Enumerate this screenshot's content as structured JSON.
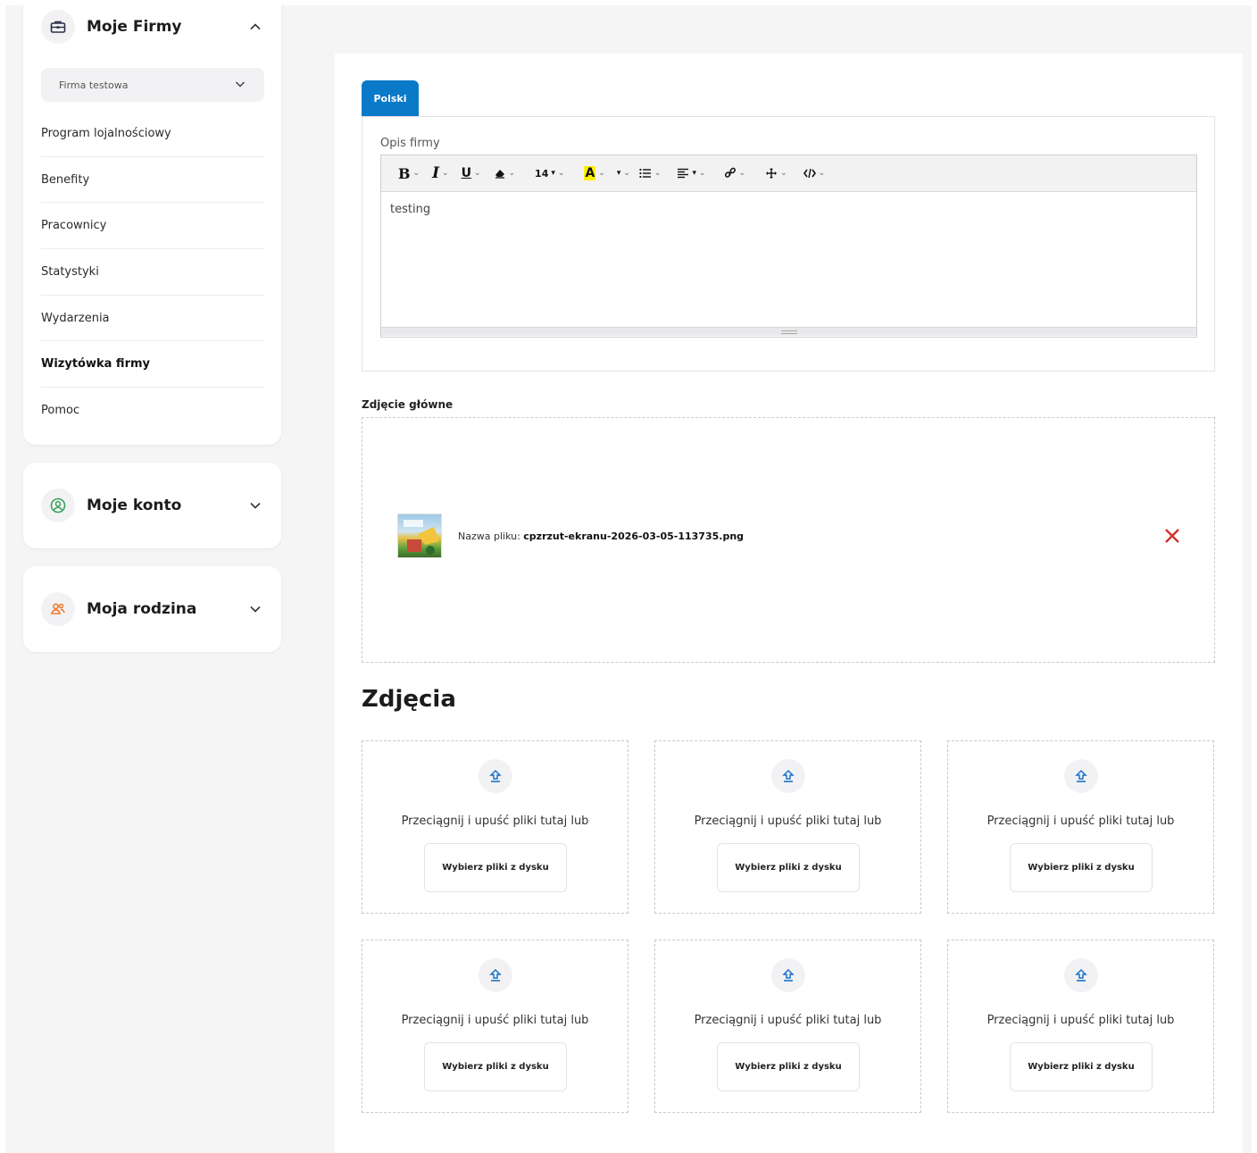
{
  "sidebar": {
    "companies": {
      "title": "Moje Firmy",
      "selected_firm": "Firma testowa",
      "menu": [
        {
          "label": "Program lojalnościowy",
          "active": false
        },
        {
          "label": "Benefity",
          "active": false
        },
        {
          "label": "Pracownicy",
          "active": false
        },
        {
          "label": "Statystyki",
          "active": false
        },
        {
          "label": "Wydarzenia",
          "active": false
        },
        {
          "label": "Wizytówka firmy",
          "active": true
        },
        {
          "label": "Pomoc",
          "active": false
        }
      ]
    },
    "account": {
      "title": "Moje konto"
    },
    "family": {
      "title": "Moja rodzina"
    }
  },
  "main": {
    "lang_tab": "Polski",
    "description": {
      "label": "Opis firmy",
      "font_size": "14",
      "content": "testing"
    },
    "main_photo": {
      "label": "Zdjęcie główne",
      "file_prefix": "Nazwa pliku: ",
      "file_name": "cpzrzut-ekranu-2026-03-05-113735.png"
    },
    "photos": {
      "title": "Zdjęcia",
      "slots": [
        {
          "text": "Przeciągnij i upuść pliki tutaj lub",
          "button": "Wybierz pliki z dysku"
        },
        {
          "text": "Przeciągnij i upuść pliki tutaj lub",
          "button": "Wybierz pliki z dysku"
        },
        {
          "text": "Przeciągnij i upuść pliki tutaj lub",
          "button": "Wybierz pliki z dysku"
        },
        {
          "text": "Przeciągnij i upuść pliki tutaj lub",
          "button": "Wybierz pliki z dysku"
        },
        {
          "text": "Przeciągnij i upuść pliki tutaj lub",
          "button": "Wybierz pliki z dysku"
        },
        {
          "text": "Przeciągnij i upuść pliki tutaj lub",
          "button": "Wybierz pliki z dysku"
        }
      ]
    }
  },
  "colors": {
    "accent": "#0a7ac8",
    "remove": "#d32f2f",
    "account_icon": "#3aa35a",
    "family_icon": "#f07a2a"
  }
}
